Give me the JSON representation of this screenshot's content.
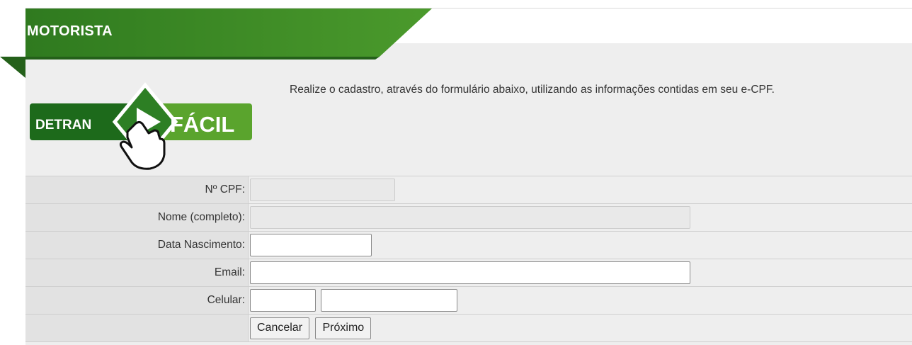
{
  "header": {
    "title": "MOTORISTA"
  },
  "logo": {
    "left_text": "DETRAN",
    "right_text": "FÁCIL"
  },
  "intro_text": "Realize o cadastro, através do formulário abaixo, utilizando as informações contidas em seu e-CPF.",
  "form": {
    "cpf": {
      "label": "Nº CPF:",
      "value": ""
    },
    "nome": {
      "label": "Nome (completo):",
      "value": ""
    },
    "data_nascimento": {
      "label": "Data Nascimento:",
      "value": ""
    },
    "email": {
      "label": "Email:",
      "value": ""
    },
    "celular": {
      "label": "Celular:",
      "ddd_value": "",
      "number_value": ""
    }
  },
  "buttons": {
    "cancel": "Cancelar",
    "next": "Próximo"
  },
  "colors": {
    "header_green": "#3e8a26",
    "header_dark_green": "#24601a",
    "panel": "#eeeeee",
    "label_bg": "#e2e2e2"
  }
}
